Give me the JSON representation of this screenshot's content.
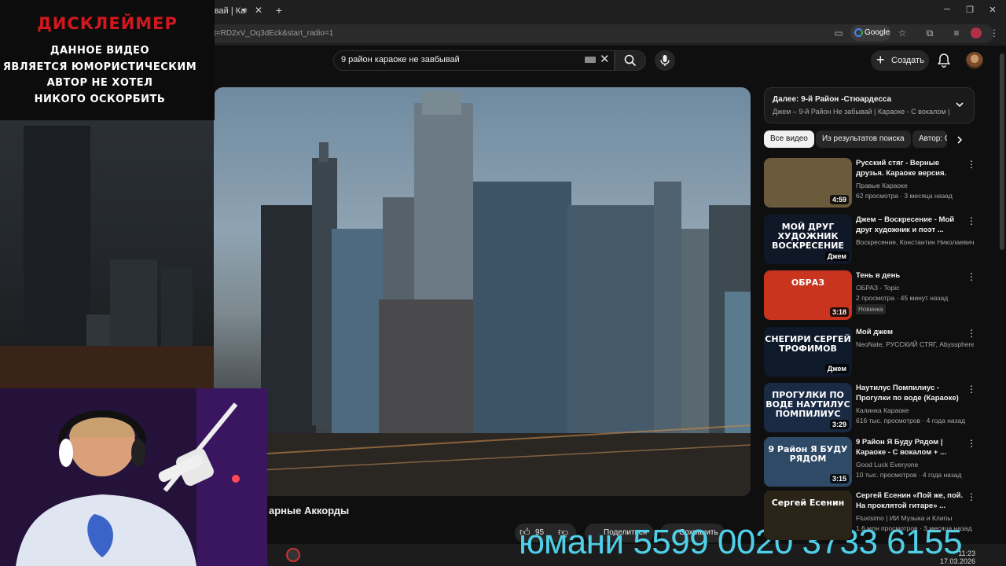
{
  "browser": {
    "tab_title": "квай | Ка",
    "url": "t=RD2xV_Oq3dEck&start_radio=1",
    "google_label": "Google"
  },
  "header": {
    "search_value": "9 район караоке не завбывай",
    "create_label": "Создать"
  },
  "disclaimer": {
    "title": "ДИСКЛЕЙМЕР",
    "lines": [
      "ДАННОЕ ВИДЕО",
      "ЯВЛЯЕТСЯ ЮМОРИСТИЧЕСКИМ",
      "АВТОР НЕ ХОТЕЛ",
      "НИКОГО ОСКОРБИТЬ"
    ]
  },
  "video": {
    "title_fragment": "арные Аккорды",
    "likes": "95",
    "share_label": "Поделиться",
    "save_label": "Сохранить"
  },
  "overlay_text": "юмани 5599 0020 3733 6155",
  "taskbar": {
    "time": "11:23",
    "date": "17.03.2026"
  },
  "sidebar": {
    "up_next_title": "Далее: 9-й Район -Стюардесса",
    "up_next_subtitle": "Джем – 9-й Район Не забывай | Караоке - С вокалом | Гита",
    "chips": [
      "Все видео",
      "Из результатов поиска",
      "Автор: G"
    ],
    "items": [
      {
        "title": "Русский стяг - Верные друзья. Караоке версия.",
        "channel": "Правые Караоке",
        "stats": "62 просмотра · 3 месяца назад",
        "duration": "4:59",
        "thumb_color": "#6b5a3c",
        "thumb_text": ""
      },
      {
        "title": "Джем – Воскресение - Мой друг художник и поэт ...",
        "channel": "Воскресение, Константин Николаевич...",
        "stats": "",
        "duration": "Джем",
        "thumb_color": "#101828",
        "thumb_text": "МОЙ ДРУГ ХУДОЖНИК ВОСКРЕСЕНИЕ"
      },
      {
        "title": "Тень в день",
        "channel": "ОБРАЗ - Topic",
        "stats": "2 просмотра · 45 минут назад",
        "duration": "3:18",
        "thumb_color": "#c8341e",
        "thumb_text": "ОБРАЗ",
        "badge": "Новинка"
      },
      {
        "title": "Мой джем",
        "channel": "NeoNate, РУССКИЙ СТЯГ, Abyssphere и...",
        "stats": "",
        "duration": "Джем",
        "thumb_color": "#0e1a2a",
        "thumb_text": "СНЕГИРИ СЕРГЕЙ ТРОФИМОВ"
      },
      {
        "title": "Наутилус Помпилиус - Прогулки по воде (Караоке)",
        "channel": "Калинка Караоке",
        "stats": "616 тыс. просмотров · 4 года назад",
        "duration": "3:29",
        "thumb_color": "#1a2a44",
        "thumb_text": "ПРОГУЛКИ ПО ВОДЕ НАУТИЛУС ПОМПИЛИУС"
      },
      {
        "title": "9 Район Я Буду Рядом | Караоке - С вокалом + ...",
        "channel": "Good Luck Everyone",
        "stats": "10 тыс. просмотров · 4 года назад",
        "duration": "3:15",
        "thumb_color": "#2e4a66",
        "thumb_text": "9 Район  Я БУДУ РЯДОМ"
      },
      {
        "title": "Сергей Есенин «Пой же, пой. На проклятой гитаре» ...",
        "channel": "Fluxisimo | ИИ Музыка и Клипы",
        "stats": "1,6 млн просмотров · 3 месяца назад",
        "duration": "",
        "thumb_color": "#2a2418",
        "thumb_text": "Сергей Есенин"
      }
    ]
  }
}
